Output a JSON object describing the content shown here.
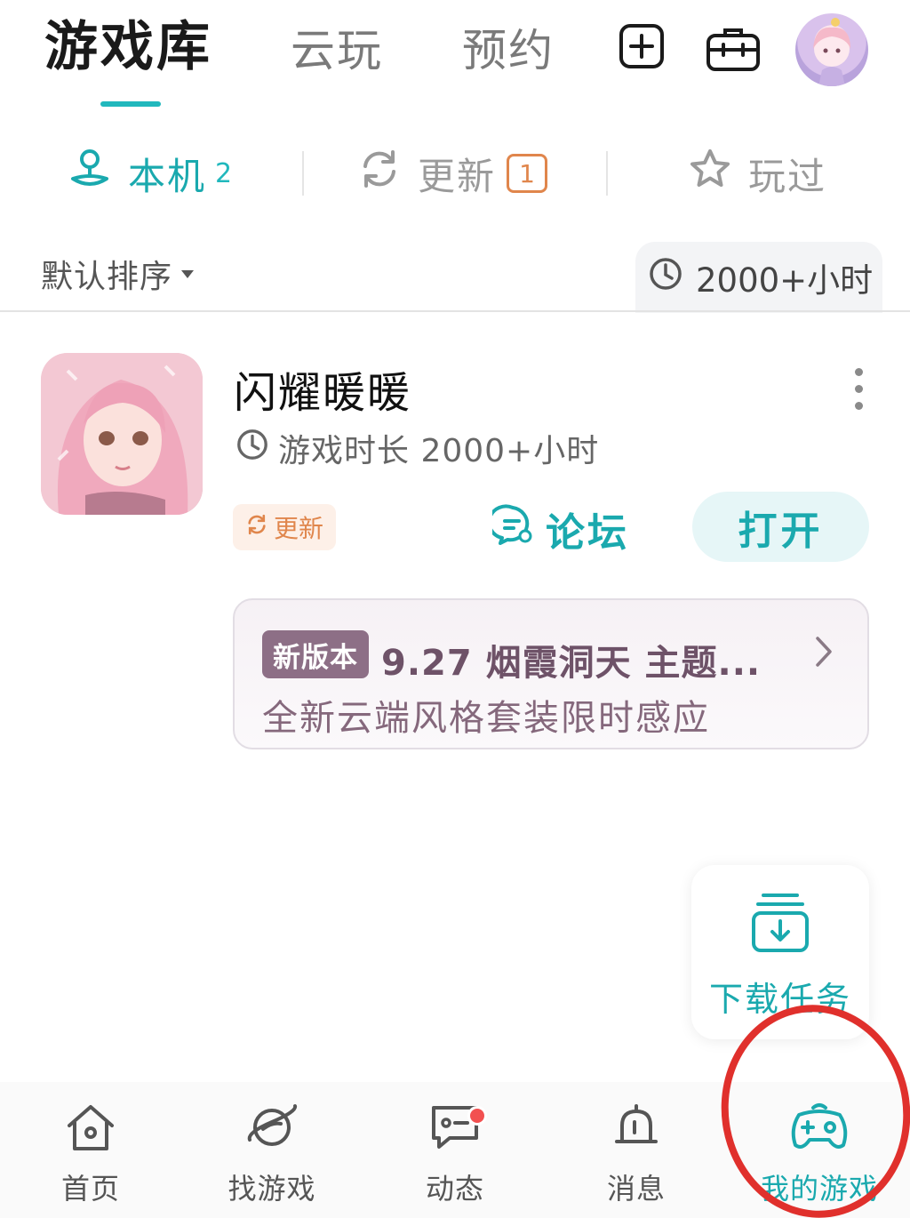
{
  "header": {
    "tabs": [
      {
        "label": "游戏库",
        "active": true
      },
      {
        "label": "云玩",
        "active": false
      },
      {
        "label": "预约",
        "active": false
      }
    ],
    "icons": [
      "add-icon",
      "toolbox-icon"
    ],
    "avatar": "user-avatar"
  },
  "segments": {
    "local": {
      "label": "本机",
      "count": "2"
    },
    "update": {
      "label": "更新",
      "badge": "1"
    },
    "played": {
      "label": "玩过"
    }
  },
  "sort": {
    "label": "默认排序",
    "total_time": "2000+小时"
  },
  "game": {
    "title": "闪耀暖暖",
    "playtime": "游戏时长 2000+小时",
    "update_tag": "更新",
    "forum_label": "论坛",
    "open_label": "打开"
  },
  "news": {
    "tag": "新版本",
    "title": "9.27 烟霞洞天 主题...",
    "subtitle": "全新云端风格套装限时感应"
  },
  "download_task": {
    "label": "下载任务"
  },
  "bottom_nav": [
    {
      "label": "首页",
      "icon": "home-icon"
    },
    {
      "label": "找游戏",
      "icon": "planet-icon"
    },
    {
      "label": "动态",
      "icon": "message-icon"
    },
    {
      "label": "消息",
      "icon": "bell-icon"
    },
    {
      "label": "我的游戏",
      "icon": "gamepad-icon",
      "active": true
    }
  ],
  "colors": {
    "accent": "#1aa9ae",
    "update_orange": "#e0864c",
    "news_purple": "#8d6f86",
    "annotation_red": "#e0302c"
  }
}
